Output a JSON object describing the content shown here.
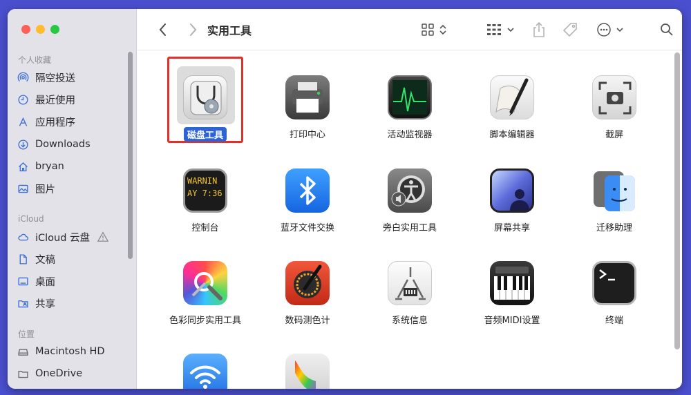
{
  "window": {
    "title": "实用工具"
  },
  "sidebar": {
    "favorites_title": "个人收藏",
    "favorites": [
      {
        "label": "隔空投送",
        "icon": "airdrop-icon"
      },
      {
        "label": "最近使用",
        "icon": "clock-icon"
      },
      {
        "label": "应用程序",
        "icon": "applications-icon"
      },
      {
        "label": "Downloads",
        "icon": "download-icon"
      },
      {
        "label": "bryan",
        "icon": "home-icon"
      },
      {
        "label": "图片",
        "icon": "photo-icon"
      }
    ],
    "icloud_title": "iCloud",
    "icloud": [
      {
        "label": "iCloud 云盘",
        "icon": "cloud-icon"
      },
      {
        "label": "文稿",
        "icon": "document-icon"
      },
      {
        "label": "桌面",
        "icon": "desktop-icon"
      },
      {
        "label": "共享",
        "icon": "shared-folder-icon"
      }
    ],
    "locations_title": "位置",
    "locations": [
      {
        "label": "Macintosh HD",
        "icon": "disk-icon"
      },
      {
        "label": "OneDrive",
        "icon": "folder-icon"
      }
    ]
  },
  "apps": [
    {
      "label": "磁盘工具",
      "icon": "disk-utility-icon",
      "selected": true
    },
    {
      "label": "打印中心",
      "icon": "printer-icon"
    },
    {
      "label": "活动监视器",
      "icon": "activity-monitor-icon"
    },
    {
      "label": "脚本编辑器",
      "icon": "script-editor-icon"
    },
    {
      "label": "截屏",
      "icon": "screenshot-icon"
    },
    {
      "label": "控制台",
      "icon": "console-icon",
      "screen_text": [
        "WARNIN",
        "AY 7:36"
      ]
    },
    {
      "label": "蓝牙文件交换",
      "icon": "bluetooth-icon"
    },
    {
      "label": "旁白实用工具",
      "icon": "voiceover-icon"
    },
    {
      "label": "屏幕共享",
      "icon": "screen-sharing-icon"
    },
    {
      "label": "迁移助理",
      "icon": "migration-assistant-icon"
    },
    {
      "label": "色彩同步实用工具",
      "icon": "colorsync-icon"
    },
    {
      "label": "数码测色计",
      "icon": "color-meter-icon"
    },
    {
      "label": "系统信息",
      "icon": "system-information-icon"
    },
    {
      "label": "音频MIDI设置",
      "icon": "audio-midi-icon"
    },
    {
      "label": "终端",
      "icon": "terminal-icon"
    },
    {
      "label": "",
      "icon": "wireless-diagnostics-icon"
    },
    {
      "label": "",
      "icon": "grapher-icon"
    }
  ],
  "colors": {
    "selection": "#2d63d2",
    "highlight_box": "#e0302a",
    "sidebar_bg": "#e4e2e9",
    "desktop": "#4a4fcf"
  }
}
